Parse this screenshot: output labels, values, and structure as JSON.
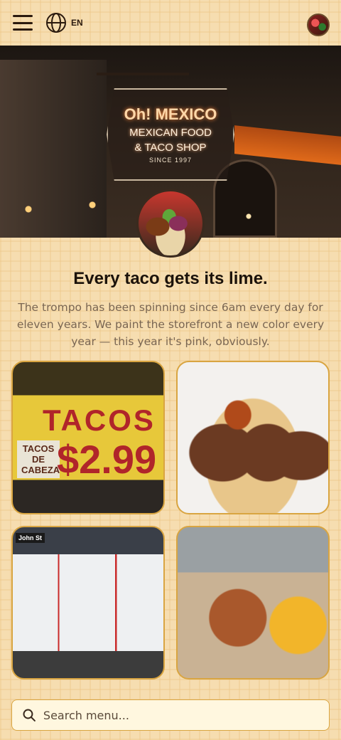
{
  "header": {
    "language_code": "EN",
    "menu_icon": "hamburger-menu-icon",
    "language_icon": "globe-icon",
    "avatar_icon": "profile-avatar"
  },
  "hero": {
    "sign_line1": "Oh! MEXICO",
    "sign_line2": "MEXICAN FOOD",
    "sign_line3": "& TACO SHOP",
    "sign_line4": "SINCE 1997"
  },
  "intro": {
    "title": "Every taco gets its lime.",
    "description": "The trompo has been spinning since 6am every day for eleven years. We paint the storefront a new color every year — this year it's pink, obviously."
  },
  "gallery": {
    "tile1": {
      "big_text": "TACOS",
      "price": "$2.99",
      "small_text": "TACOS DE CABEZA"
    },
    "tile3": {
      "sign": "John St"
    }
  },
  "search": {
    "placeholder": "Search menu...",
    "value": "",
    "icon": "search-icon"
  },
  "colors": {
    "background": "#f6ddb0",
    "accent_border": "#d9a541",
    "title_text": "#1b120a",
    "body_text": "#7a6652"
  }
}
